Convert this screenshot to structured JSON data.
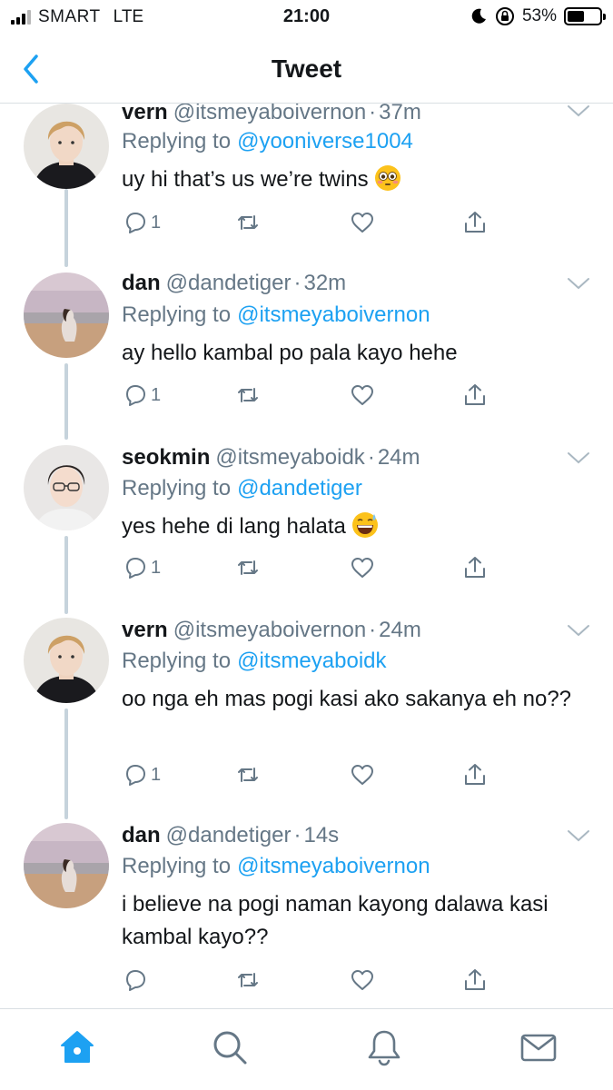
{
  "status_bar": {
    "carrier": "SMART",
    "network": "LTE",
    "time": "21:00",
    "battery": "53%",
    "battery_level": 0.53
  },
  "nav": {
    "title": "Tweet",
    "back_icon": "chevron-left-icon"
  },
  "colors": {
    "accent": "#1da1f2",
    "secondary_text": "#657786",
    "thread_line": "#c6d3dc",
    "divider": "#d9dfe3"
  },
  "tweets": [
    {
      "name": "vern",
      "handle": "@itsmeyaboivernon",
      "separator": "·",
      "time": "37m",
      "replying_prefix": "Replying to",
      "replying_to": "@yooniverse1004",
      "text": "uy hi that’s us we’re twins",
      "emoji": "flushed-face-emoji",
      "reply_count": "1"
    },
    {
      "name": "dan",
      "handle": "@dandetiger",
      "separator": "·",
      "time": "32m",
      "replying_prefix": "Replying to",
      "replying_to": "@itsmeyaboivernon",
      "text": "ay hello kambal po pala kayo hehe",
      "reply_count": "1"
    },
    {
      "name": "seokmin",
      "handle": "@itsmeyaboidk",
      "separator": "·",
      "time": "24m",
      "replying_prefix": "Replying to",
      "replying_to": "@dandetiger",
      "text": "yes hehe di lang halata",
      "emoji": "grinning-sweat-emoji",
      "reply_count": "1"
    },
    {
      "name": "vern",
      "handle": "@itsmeyaboivernon",
      "separator": "·",
      "time": "24m",
      "replying_prefix": "Replying to",
      "replying_to": "@itsmeyaboidk",
      "text": "oo nga eh mas pogi kasi ako sakanya eh no??",
      "reply_count": "1"
    },
    {
      "name": "dan",
      "handle": "@dandetiger",
      "separator": "·",
      "time": "14s",
      "replying_prefix": "Replying to",
      "replying_to": "@itsmeyaboivernon",
      "text": "i believe na pogi naman kayong dalawa kasi kambal kayo??",
      "reply_count": ""
    }
  ],
  "tab_bar": {
    "items": [
      "home-icon",
      "search-icon",
      "notifications-bell-icon",
      "messages-envelope-icon"
    ],
    "active": "home-icon"
  }
}
